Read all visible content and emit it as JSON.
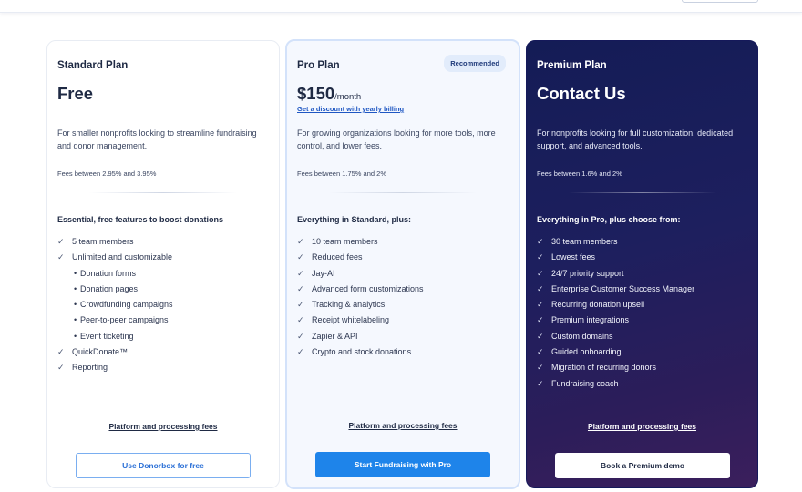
{
  "plans": [
    {
      "name": "Standard Plan",
      "price": "Free",
      "description": "For smaller nonprofits looking to streamline fundraising and donor management.",
      "fees": "Fees between 2.95% and 3.95%",
      "features_heading": "Essential, free features to boost donations",
      "features": [
        {
          "label": "5 team members",
          "type": "check"
        },
        {
          "label": "Unlimited and customizable",
          "type": "check"
        },
        {
          "label": "Donation forms",
          "type": "sub"
        },
        {
          "label": "Donation pages",
          "type": "sub"
        },
        {
          "label": "Crowdfunding campaigns",
          "type": "sub"
        },
        {
          "label": "Peer-to-peer campaigns",
          "type": "sub"
        },
        {
          "label": "Event ticketing",
          "type": "sub"
        },
        {
          "label": "QuickDonate™",
          "type": "check"
        },
        {
          "label": "Reporting",
          "type": "check"
        }
      ],
      "fees_link": "Platform and processing fees",
      "cta": "Use Donorbox for free"
    },
    {
      "name": "Pro Plan",
      "price": "$150",
      "price_unit": "/month",
      "discount_link": "Get a discount with yearly billing",
      "badge": "Recommended",
      "description": "For growing organizations looking for more tools, more control, and lower fees.",
      "fees": "Fees between 1.75% and 2%",
      "features_heading": "Everything in Standard, plus:",
      "features": [
        {
          "label": "10 team members",
          "type": "check"
        },
        {
          "label": "Reduced fees",
          "type": "check"
        },
        {
          "label": "Jay-AI",
          "type": "check"
        },
        {
          "label": "Advanced form customizations",
          "type": "check"
        },
        {
          "label": "Tracking & analytics",
          "type": "check"
        },
        {
          "label": "Receipt whitelabeling",
          "type": "check"
        },
        {
          "label": "Zapier & API",
          "type": "check"
        },
        {
          "label": "Crypto and stock donations",
          "type": "check"
        }
      ],
      "fees_link": "Platform and processing fees",
      "cta": "Start Fundraising with Pro"
    },
    {
      "name": "Premium Plan",
      "price": "Contact Us",
      "description": "For nonprofits looking for full customization, dedicated support, and advanced tools.",
      "fees": "Fees between 1.6% and 2%",
      "features_heading": "Everything in Pro, plus choose from:",
      "features": [
        {
          "label": "30 team members",
          "type": "check"
        },
        {
          "label": "Lowest fees",
          "type": "check"
        },
        {
          "label": "24/7 priority support",
          "type": "check"
        },
        {
          "label": "Enterprise Customer Success Manager",
          "type": "check"
        },
        {
          "label": "Recurring donation upsell",
          "type": "check"
        },
        {
          "label": "Premium integrations",
          "type": "check"
        },
        {
          "label": "Custom domains",
          "type": "check"
        },
        {
          "label": "Guided onboarding",
          "type": "check"
        },
        {
          "label": "Migration of recurring donors",
          "type": "check"
        },
        {
          "label": "Fundraising coach",
          "type": "check"
        }
      ],
      "fees_link": "Platform and processing fees",
      "cta": "Book a Premium demo"
    }
  ],
  "icons": {
    "check": "✓",
    "bullet": "•"
  },
  "colors": {
    "accent": "#1e84ea",
    "premium_bg": "#141c56",
    "badge_bg": "#e2ecfb",
    "link": "#1f57c3"
  }
}
